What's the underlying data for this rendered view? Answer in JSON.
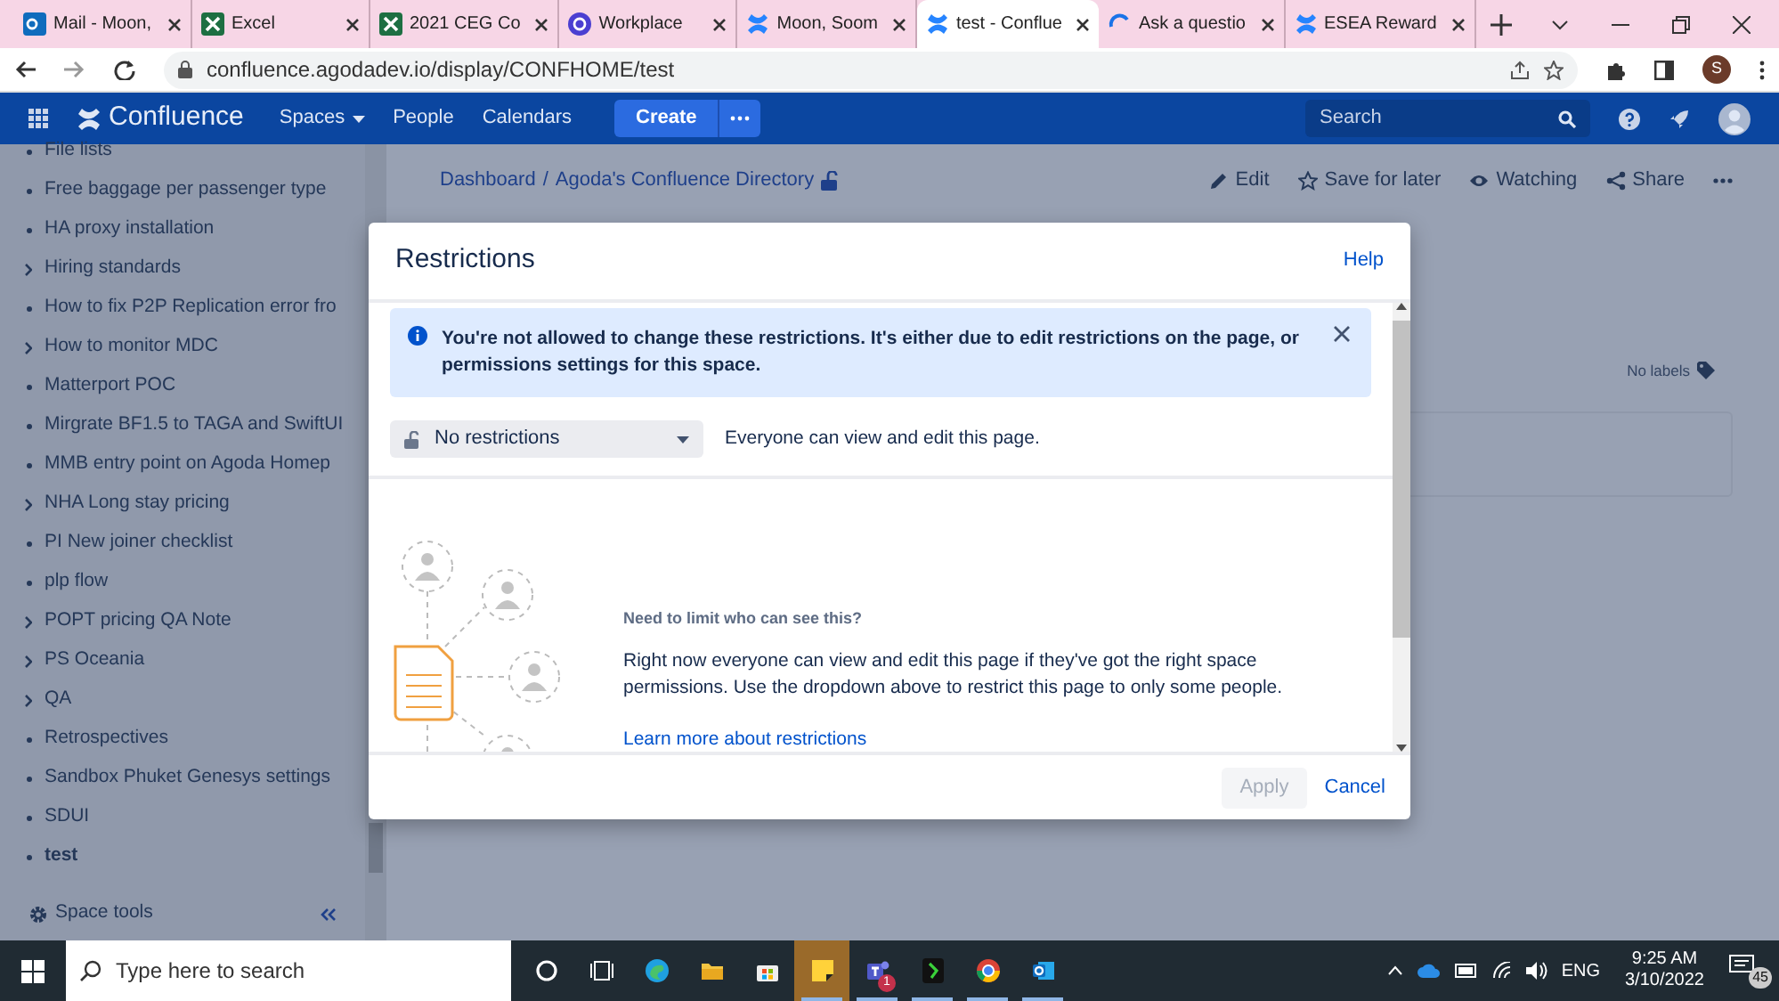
{
  "browser": {
    "tabs": [
      {
        "title": "Mail - Moon,",
        "kind": "mail",
        "selected": false
      },
      {
        "title": "Excel",
        "kind": "sheet",
        "selected": false
      },
      {
        "title": "2021 CEG Co",
        "kind": "sheet",
        "selected": false
      },
      {
        "title": "Workplace",
        "kind": "workplace",
        "selected": false
      },
      {
        "title": "Moon, Soom",
        "kind": "confluence",
        "selected": false
      },
      {
        "title": "test - Conflue",
        "kind": "confluence",
        "selected": true
      },
      {
        "title": "Ask a questio",
        "kind": "loading",
        "selected": false
      },
      {
        "title": "ESEA Reward",
        "kind": "confluence",
        "selected": false
      }
    ],
    "address": "confluence.agodadev.io/display/CONFHOME/test",
    "profile_initial": "S"
  },
  "header": {
    "product": "Confluence",
    "nav": [
      {
        "label": "Spaces",
        "dropdown": true
      },
      {
        "label": "People",
        "dropdown": false
      },
      {
        "label": "Calendars",
        "dropdown": false
      }
    ],
    "create": "Create",
    "search_placeholder": "Search"
  },
  "sidebar": {
    "items": [
      {
        "label": "File lists",
        "kind": "page",
        "selected": false
      },
      {
        "label": "Free baggage per passenger type",
        "kind": "page",
        "selected": false
      },
      {
        "label": "HA proxy installation",
        "kind": "page",
        "selected": false
      },
      {
        "label": "Hiring standards",
        "kind": "parent",
        "selected": false
      },
      {
        "label": "How to fix P2P Replication error fro",
        "kind": "page",
        "selected": false
      },
      {
        "label": "How to monitor MDC",
        "kind": "parent",
        "selected": false
      },
      {
        "label": "Matterport POC",
        "kind": "page",
        "selected": false
      },
      {
        "label": "Mirgrate BF1.5 to TAGA and SwiftUI",
        "kind": "page",
        "selected": false
      },
      {
        "label": "MMB entry point on Agoda Homep",
        "kind": "page",
        "selected": false
      },
      {
        "label": "NHA Long stay pricing",
        "kind": "parent",
        "selected": false
      },
      {
        "label": "PI New joiner checklist",
        "kind": "page",
        "selected": false
      },
      {
        "label": "plp flow",
        "kind": "page",
        "selected": false
      },
      {
        "label": "POPT pricing QA Note",
        "kind": "parent",
        "selected": false
      },
      {
        "label": "PS Oceania",
        "kind": "parent",
        "selected": false
      },
      {
        "label": "QA",
        "kind": "parent",
        "selected": false
      },
      {
        "label": "Retrospectives",
        "kind": "page",
        "selected": false
      },
      {
        "label": "Sandbox Phuket Genesys settings",
        "kind": "page",
        "selected": false
      },
      {
        "label": "SDUI",
        "kind": "page",
        "selected": false
      },
      {
        "label": "test",
        "kind": "page",
        "selected": true
      }
    ],
    "space_tools": "Space tools"
  },
  "page": {
    "breadcrumbs": [
      "Dashboard",
      "Agoda's Confluence Directory"
    ],
    "breadcrumb_separator": "/",
    "actions": [
      {
        "label": "Edit",
        "kind": "edit"
      },
      {
        "label": "Save for later",
        "kind": "star"
      },
      {
        "label": "Watching",
        "kind": "eye"
      },
      {
        "label": "Share",
        "kind": "share"
      }
    ],
    "labels": "No labels"
  },
  "dialog": {
    "title": "Restrictions",
    "help": "Help",
    "notice": "You're not allowed to change these restrictions. It's either due to edit restrictions on the page, or permissions settings for this space.",
    "dropdown": "No restrictions",
    "dropdown_note": "Everyone can view and edit this page.",
    "heading": "Need to limit who can see this?",
    "body": "Right now everyone can view and edit this page if they've got the right space permissions. Use the dropdown above to restrict this page to only some people.",
    "link": "Learn more about restrictions",
    "apply": {
      "label": "Apply",
      "disabled": true
    },
    "cancel": "Cancel"
  },
  "taskbar": {
    "search_placeholder": "Type here to search",
    "apps": [
      {
        "kind": "cortana",
        "running": false,
        "active": false
      },
      {
        "kind": "taskview",
        "running": false,
        "active": false
      },
      {
        "kind": "edge",
        "running": false,
        "active": false
      },
      {
        "kind": "folder",
        "running": false,
        "active": false
      },
      {
        "kind": "store",
        "running": false,
        "active": false
      },
      {
        "kind": "notes",
        "running": true,
        "active": true
      },
      {
        "kind": "teams",
        "running": true,
        "active": false,
        "badge": "1"
      },
      {
        "kind": "app",
        "running": true,
        "active": false
      },
      {
        "kind": "chrome",
        "running": true,
        "active": false
      },
      {
        "kind": "outlook",
        "running": true,
        "active": false
      }
    ],
    "language": "ENG",
    "time": "9:25 AM",
    "date": "3/10/2022",
    "notifications": "45"
  }
}
